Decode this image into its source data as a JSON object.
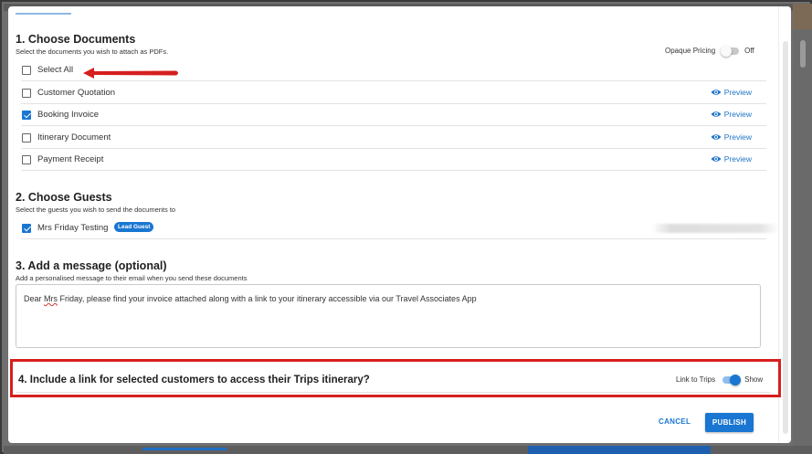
{
  "section1": {
    "title": "1. Choose Documents",
    "subtitle": "Select the documents you wish to attach as PDFs.",
    "opaque_pricing": {
      "label": "Opaque Pricing",
      "state": "Off"
    },
    "select_all": "Select All",
    "documents": [
      {
        "label": "Customer Quotation",
        "checked": false,
        "preview": "Preview"
      },
      {
        "label": "Booking Invoice",
        "checked": true,
        "preview": "Preview"
      },
      {
        "label": "Itinerary Document",
        "checked": false,
        "preview": "Preview"
      },
      {
        "label": "Payment Receipt",
        "checked": false,
        "preview": "Preview"
      }
    ]
  },
  "section2": {
    "title": "2. Choose Guests",
    "subtitle": "Select the guests you wish to send the documents to",
    "guests": [
      {
        "name": "Mrs Friday Testing",
        "badge": "Lead Guest",
        "checked": true
      }
    ]
  },
  "section3": {
    "title": "3. Add a message (optional)",
    "subtitle": "Add a personalised message to their email when you send these documents",
    "message_prefix": "Dear ",
    "message_name": "Mrs",
    "message_rest": " Friday, please find your invoice attached along with a link to your itinerary accessible via our Travel Associates App"
  },
  "section4": {
    "title": "4. Include a link for selected customers to access their Trips itinerary?",
    "toggle_label": "Link to Trips",
    "toggle_state": "Show"
  },
  "actions": {
    "cancel": "CANCEL",
    "publish": "PUBLISH"
  },
  "colors": {
    "accent": "#1976d2",
    "highlight_border": "#d61f1f"
  }
}
